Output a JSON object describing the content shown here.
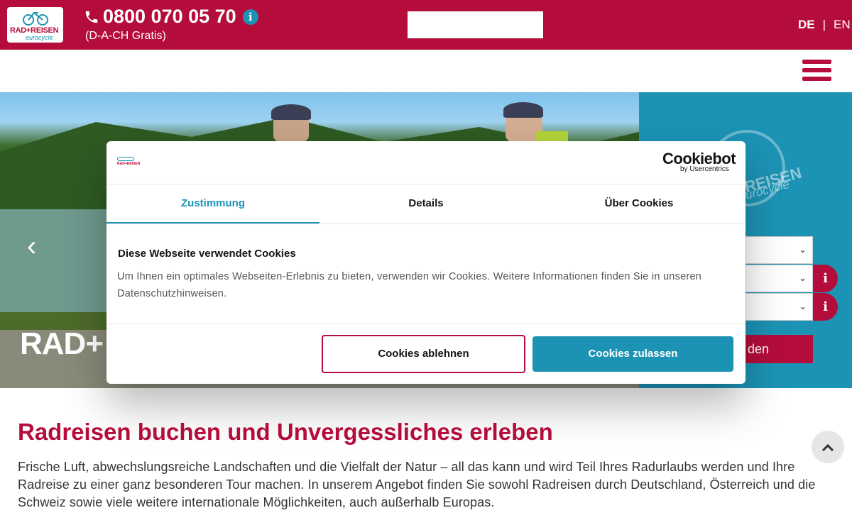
{
  "header": {
    "logo_text": "RAD+REISEN",
    "logo_sub": "eurocycle",
    "phone": "0800 070 05 70",
    "phone_note": "(D-A-CH Gratis)",
    "lang_active": "DE",
    "lang_sep": "|",
    "lang_other": "EN"
  },
  "hero": {
    "title": "RAD+",
    "prev_arrow": "‹",
    "side_logo_1": "REISEN",
    "side_logo_2": "eurocycle",
    "search_button": "den"
  },
  "cookie_dialog": {
    "logo_text": "RAD+REISEN",
    "cookiebot_brand": "Cookiebot",
    "cookiebot_sub": "by Usercentrics",
    "tabs": [
      {
        "label": "Zustimmung"
      },
      {
        "label": "Details"
      },
      {
        "label": "Über Cookies"
      }
    ],
    "heading": "Diese Webseite verwendet Cookies",
    "text": "Um Ihnen ein optimales Webseiten-Erlebnis zu bieten, verwenden wir Cookies. Weitere Informationen finden Sie in unseren Datenschutzhinweisen.",
    "decline_label": "Cookies ablehnen",
    "accept_label": "Cookies zulassen"
  },
  "main": {
    "heading": "Radreisen buchen und Unvergessliches erleben",
    "text": "Frische Luft, abwechslungsreiche Landschaften und die Vielfalt der Natur – all das kann und wird Teil Ihres Radurlaubs werden und Ihre Radreise zu einer ganz besonderen Tour machen. In unserem Angebot finden Sie sowohl Radreisen durch Deutschland, Österreich und die Schweiz sowie viele weitere internationale Möglichkeiten, auch außerhalb Europas."
  },
  "icons": {
    "phone": "phone-icon",
    "info": "info-icon",
    "menu": "hamburger-menu-icon",
    "chevron": "chevron-down-icon",
    "to_top": "chevron-up-icon"
  },
  "colors": {
    "brand_red": "#b50d3b",
    "brand_teal": "#1c93b5"
  }
}
